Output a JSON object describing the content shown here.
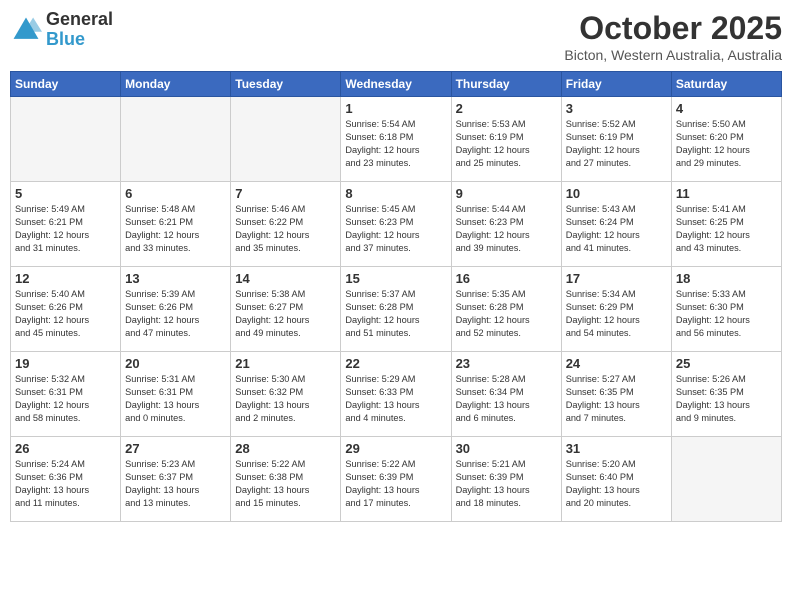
{
  "header": {
    "logo_general": "General",
    "logo_blue": "Blue",
    "month": "October 2025",
    "location": "Bicton, Western Australia, Australia"
  },
  "days_of_week": [
    "Sunday",
    "Monday",
    "Tuesday",
    "Wednesday",
    "Thursday",
    "Friday",
    "Saturday"
  ],
  "weeks": [
    [
      {
        "day": "",
        "info": ""
      },
      {
        "day": "",
        "info": ""
      },
      {
        "day": "",
        "info": ""
      },
      {
        "day": "1",
        "info": "Sunrise: 5:54 AM\nSunset: 6:18 PM\nDaylight: 12 hours\nand 23 minutes."
      },
      {
        "day": "2",
        "info": "Sunrise: 5:53 AM\nSunset: 6:19 PM\nDaylight: 12 hours\nand 25 minutes."
      },
      {
        "day": "3",
        "info": "Sunrise: 5:52 AM\nSunset: 6:19 PM\nDaylight: 12 hours\nand 27 minutes."
      },
      {
        "day": "4",
        "info": "Sunrise: 5:50 AM\nSunset: 6:20 PM\nDaylight: 12 hours\nand 29 minutes."
      }
    ],
    [
      {
        "day": "5",
        "info": "Sunrise: 5:49 AM\nSunset: 6:21 PM\nDaylight: 12 hours\nand 31 minutes."
      },
      {
        "day": "6",
        "info": "Sunrise: 5:48 AM\nSunset: 6:21 PM\nDaylight: 12 hours\nand 33 minutes."
      },
      {
        "day": "7",
        "info": "Sunrise: 5:46 AM\nSunset: 6:22 PM\nDaylight: 12 hours\nand 35 minutes."
      },
      {
        "day": "8",
        "info": "Sunrise: 5:45 AM\nSunset: 6:23 PM\nDaylight: 12 hours\nand 37 minutes."
      },
      {
        "day": "9",
        "info": "Sunrise: 5:44 AM\nSunset: 6:23 PM\nDaylight: 12 hours\nand 39 minutes."
      },
      {
        "day": "10",
        "info": "Sunrise: 5:43 AM\nSunset: 6:24 PM\nDaylight: 12 hours\nand 41 minutes."
      },
      {
        "day": "11",
        "info": "Sunrise: 5:41 AM\nSunset: 6:25 PM\nDaylight: 12 hours\nand 43 minutes."
      }
    ],
    [
      {
        "day": "12",
        "info": "Sunrise: 5:40 AM\nSunset: 6:26 PM\nDaylight: 12 hours\nand 45 minutes."
      },
      {
        "day": "13",
        "info": "Sunrise: 5:39 AM\nSunset: 6:26 PM\nDaylight: 12 hours\nand 47 minutes."
      },
      {
        "day": "14",
        "info": "Sunrise: 5:38 AM\nSunset: 6:27 PM\nDaylight: 12 hours\nand 49 minutes."
      },
      {
        "day": "15",
        "info": "Sunrise: 5:37 AM\nSunset: 6:28 PM\nDaylight: 12 hours\nand 51 minutes."
      },
      {
        "day": "16",
        "info": "Sunrise: 5:35 AM\nSunset: 6:28 PM\nDaylight: 12 hours\nand 52 minutes."
      },
      {
        "day": "17",
        "info": "Sunrise: 5:34 AM\nSunset: 6:29 PM\nDaylight: 12 hours\nand 54 minutes."
      },
      {
        "day": "18",
        "info": "Sunrise: 5:33 AM\nSunset: 6:30 PM\nDaylight: 12 hours\nand 56 minutes."
      }
    ],
    [
      {
        "day": "19",
        "info": "Sunrise: 5:32 AM\nSunset: 6:31 PM\nDaylight: 12 hours\nand 58 minutes."
      },
      {
        "day": "20",
        "info": "Sunrise: 5:31 AM\nSunset: 6:31 PM\nDaylight: 13 hours\nand 0 minutes."
      },
      {
        "day": "21",
        "info": "Sunrise: 5:30 AM\nSunset: 6:32 PM\nDaylight: 13 hours\nand 2 minutes."
      },
      {
        "day": "22",
        "info": "Sunrise: 5:29 AM\nSunset: 6:33 PM\nDaylight: 13 hours\nand 4 minutes."
      },
      {
        "day": "23",
        "info": "Sunrise: 5:28 AM\nSunset: 6:34 PM\nDaylight: 13 hours\nand 6 minutes."
      },
      {
        "day": "24",
        "info": "Sunrise: 5:27 AM\nSunset: 6:35 PM\nDaylight: 13 hours\nand 7 minutes."
      },
      {
        "day": "25",
        "info": "Sunrise: 5:26 AM\nSunset: 6:35 PM\nDaylight: 13 hours\nand 9 minutes."
      }
    ],
    [
      {
        "day": "26",
        "info": "Sunrise: 5:24 AM\nSunset: 6:36 PM\nDaylight: 13 hours\nand 11 minutes."
      },
      {
        "day": "27",
        "info": "Sunrise: 5:23 AM\nSunset: 6:37 PM\nDaylight: 13 hours\nand 13 minutes."
      },
      {
        "day": "28",
        "info": "Sunrise: 5:22 AM\nSunset: 6:38 PM\nDaylight: 13 hours\nand 15 minutes."
      },
      {
        "day": "29",
        "info": "Sunrise: 5:22 AM\nSunset: 6:39 PM\nDaylight: 13 hours\nand 17 minutes."
      },
      {
        "day": "30",
        "info": "Sunrise: 5:21 AM\nSunset: 6:39 PM\nDaylight: 13 hours\nand 18 minutes."
      },
      {
        "day": "31",
        "info": "Sunrise: 5:20 AM\nSunset: 6:40 PM\nDaylight: 13 hours\nand 20 minutes."
      },
      {
        "day": "",
        "info": ""
      }
    ]
  ]
}
